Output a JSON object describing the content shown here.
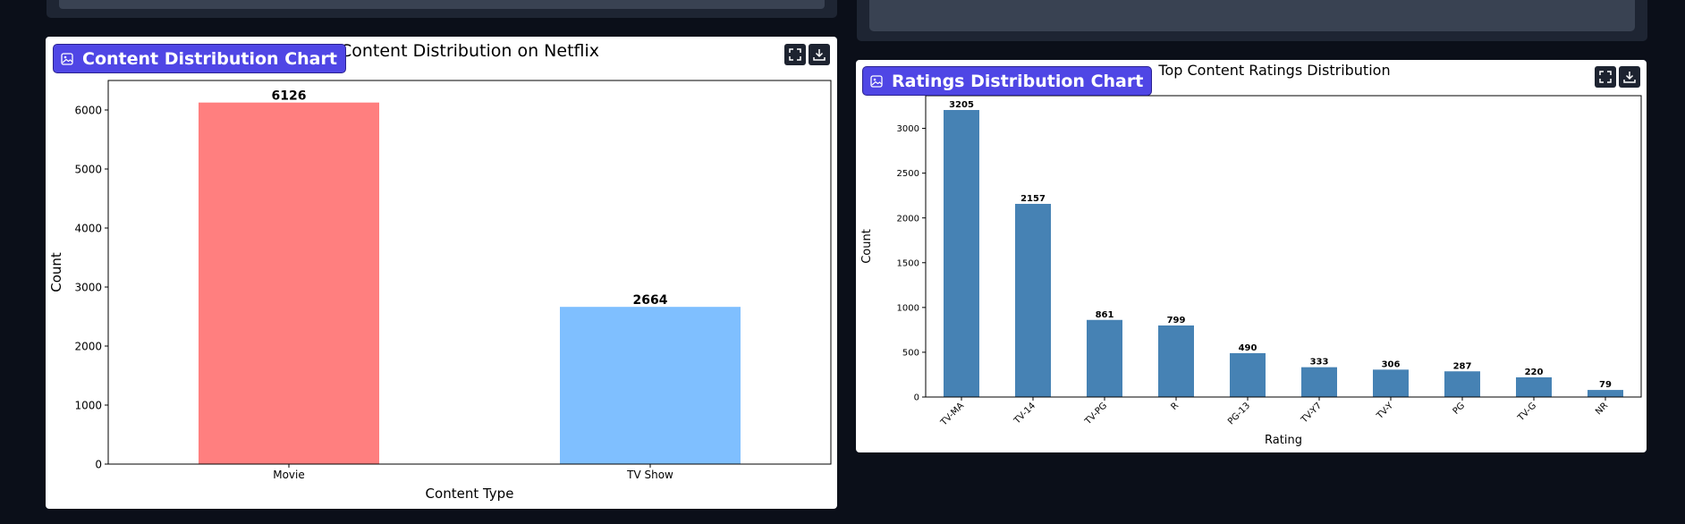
{
  "panels": {
    "left": {
      "badge_label": "Content Distribution Chart"
    },
    "right": {
      "badge_label": "Ratings Distribution Chart"
    }
  },
  "toolbar": {
    "fullscreen_icon": "fullscreen-icon",
    "download_icon": "download-icon"
  },
  "chart_data": [
    {
      "type": "bar",
      "title": "Content Distribution on Netflix",
      "xlabel": "Content Type",
      "ylabel": "Count",
      "categories": [
        "Movie",
        "TV Show"
      ],
      "values": [
        6126,
        2664
      ],
      "colors": [
        "#ff7f7f",
        "#7fbfff"
      ],
      "ylim": [
        0,
        6500
      ],
      "yticks": [
        0,
        1000,
        2000,
        3000,
        4000,
        5000,
        6000
      ],
      "grid": false,
      "data_labels": true
    },
    {
      "type": "bar",
      "title": "Top Content Ratings Distribution",
      "xlabel": "Rating",
      "ylabel": "Count",
      "categories": [
        "TV-MA",
        "TV-14",
        "TV-PG",
        "R",
        "PG-13",
        "TV-Y7",
        "TV-Y",
        "PG",
        "TV-G",
        "NR"
      ],
      "values": [
        3205,
        2157,
        861,
        799,
        490,
        333,
        306,
        287,
        220,
        79
      ],
      "color": "#4682b4",
      "ylim": [
        0,
        3365
      ],
      "yticks": [
        0,
        500,
        1000,
        1500,
        2000,
        2500,
        3000
      ],
      "grid": false,
      "data_labels": true
    }
  ]
}
